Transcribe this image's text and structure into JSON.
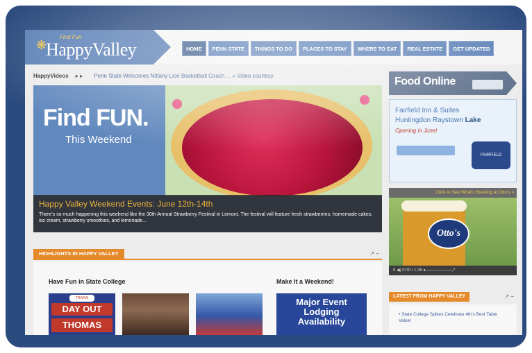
{
  "logo": {
    "small": "Find Fun",
    "name": "HappyValley"
  },
  "nav": [
    "HOME",
    "PENN STATE",
    "THINGS TO DO",
    "PLACES TO STAY",
    "WHERE TO EAT",
    "REAL ESTATE",
    "GET UPDATED"
  ],
  "breadcrumb": {
    "section": "HappyVideos",
    "sep": "▸ ▸",
    "news": "Penn State Welcomes Nittany Lion Basketball Coach ... » Video courtesy"
  },
  "hero": {
    "headline": "Find FUN.",
    "subline": "This Weekend",
    "title": "Happy Valley Weekend Events: June 12th-14th",
    "description": "There's so much happening this weekend like the 30th Annual Strawberry Festival in Lemont. The festival will feature fresh strawberries, homemade cakes, ice cream, strawberry smoothies, and lemonade..."
  },
  "highlights": {
    "tab": "HIGHLIGHTS IN HAPPY VALLEY",
    "tools": "↗ −",
    "left_heading": "Have Fun in State College",
    "right_heading": "Make It a Weekend!",
    "thomas_top": "TRAINS",
    "thomas_line1": "DAY OUT",
    "thomas_line2": "THOMAS",
    "promo_lines": [
      "Major Event",
      "Lodging",
      "Availability"
    ]
  },
  "sidebar": {
    "food_banner": "Food Online",
    "ad": {
      "line1": "Fairfield Inn & Suites",
      "line2a": "Huntingdon Raystown ",
      "line2b": "Lake",
      "line3": "Opening in June!",
      "logo": "FAIRFIELD"
    },
    "video_link": "Click to See What's Brewing at Otto's »",
    "video_brand": "Otto's",
    "controls": "II  ◀)  0:00 / 1:26   ●——————  ⤢",
    "latest_tab": "LATEST FROM HAPPY VALLEY",
    "latest_tools": "↗ −",
    "latest_item": "• State College Spikes Celebrate 4th's Best Table Value!"
  }
}
